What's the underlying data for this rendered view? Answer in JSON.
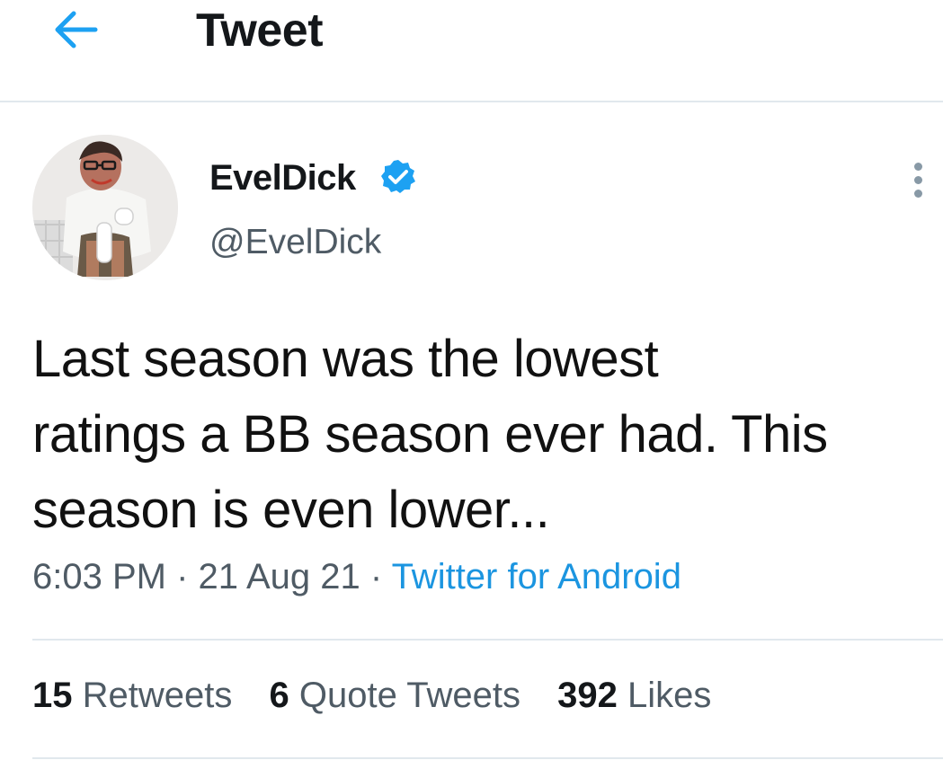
{
  "header": {
    "title": "Tweet",
    "back_icon": "arrow-left-icon",
    "accent_color": "#1da1f2"
  },
  "author": {
    "display_name": "EvelDick",
    "handle": "@EvelDick",
    "verified": true,
    "verified_icon": "verified-badge-icon",
    "more_icon": "more-vertical-icon"
  },
  "tweet": {
    "text_lines": [
      "Last season was the lowest",
      "ratings a BB season ever had. This",
      "season is even lower..."
    ],
    "time": "6:03 PM",
    "date": "21 Aug 21",
    "separator": "·",
    "source": "Twitter for Android",
    "source_color": "#1b95e0"
  },
  "stats": {
    "retweets_count": "15",
    "retweets_label": "Retweets",
    "quotes_count": "6",
    "quotes_label": "Quote Tweets",
    "likes_count": "392",
    "likes_label": "Likes"
  }
}
